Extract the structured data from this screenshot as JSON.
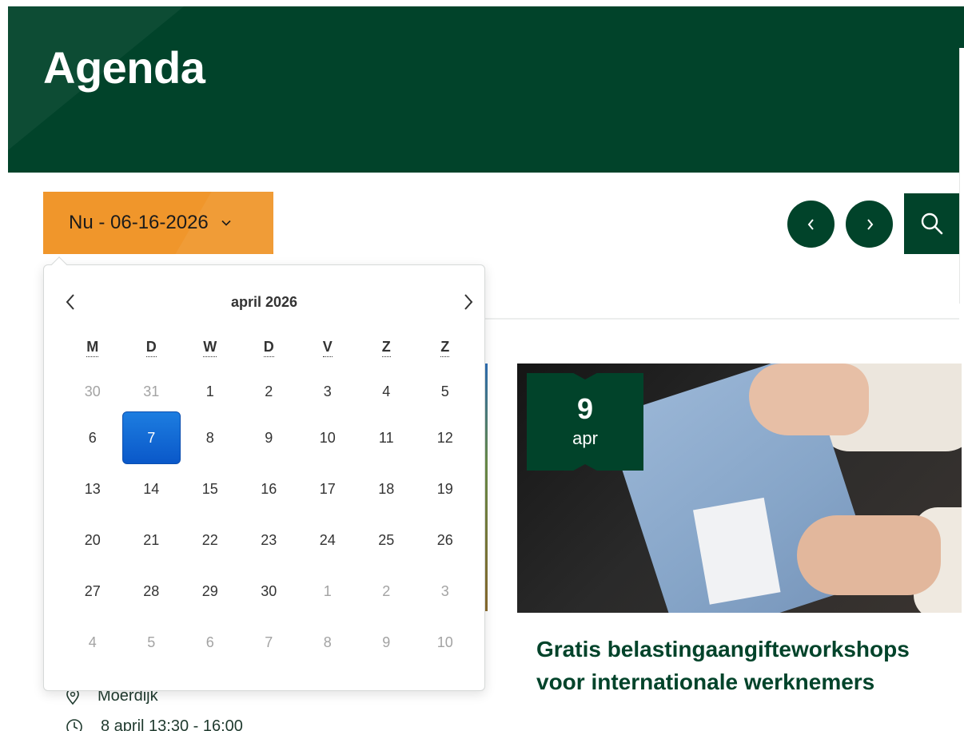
{
  "header": {
    "title": "Agenda",
    "background_color": "#01432a"
  },
  "toolbar": {
    "date_filter_label": "Nu - 06-16-2026",
    "date_filter_color": "#f0962b",
    "prev_icon": "chevron-left-icon",
    "next_icon": "chevron-right-icon",
    "search_icon": "search-icon"
  },
  "datepicker": {
    "month_label": "april 2026",
    "weekdays": [
      "M",
      "D",
      "W",
      "D",
      "V",
      "Z",
      "Z"
    ],
    "weeks": [
      [
        {
          "d": "30",
          "m": true
        },
        {
          "d": "31",
          "m": true
        },
        {
          "d": "1"
        },
        {
          "d": "2"
        },
        {
          "d": "3"
        },
        {
          "d": "4"
        },
        {
          "d": "5"
        }
      ],
      [
        {
          "d": "6"
        },
        {
          "d": "7",
          "s": true
        },
        {
          "d": "8"
        },
        {
          "d": "9"
        },
        {
          "d": "10"
        },
        {
          "d": "11"
        },
        {
          "d": "12"
        }
      ],
      [
        {
          "d": "13"
        },
        {
          "d": "14"
        },
        {
          "d": "15"
        },
        {
          "d": "16"
        },
        {
          "d": "17"
        },
        {
          "d": "18"
        },
        {
          "d": "19"
        }
      ],
      [
        {
          "d": "20"
        },
        {
          "d": "21"
        },
        {
          "d": "22"
        },
        {
          "d": "23"
        },
        {
          "d": "24"
        },
        {
          "d": "25"
        },
        {
          "d": "26"
        }
      ],
      [
        {
          "d": "27"
        },
        {
          "d": "28"
        },
        {
          "d": "29"
        },
        {
          "d": "30"
        },
        {
          "d": "1",
          "m": true
        },
        {
          "d": "2",
          "m": true
        },
        {
          "d": "3",
          "m": true
        }
      ],
      [
        {
          "d": "4",
          "m": true
        },
        {
          "d": "5",
          "m": true
        },
        {
          "d": "6",
          "m": true
        },
        {
          "d": "7",
          "m": true
        },
        {
          "d": "8",
          "m": true
        },
        {
          "d": "9",
          "m": true
        },
        {
          "d": "10",
          "m": true
        }
      ]
    ],
    "selected_color": "#0a58c9"
  },
  "left_event": {
    "location": "Moerdijk",
    "time": "8 april 13:30 - 16:00"
  },
  "right_event": {
    "badge_day": "9",
    "badge_month": "apr",
    "title": "Gratis belastingaangifteworkshops voor internationale werknemers"
  }
}
